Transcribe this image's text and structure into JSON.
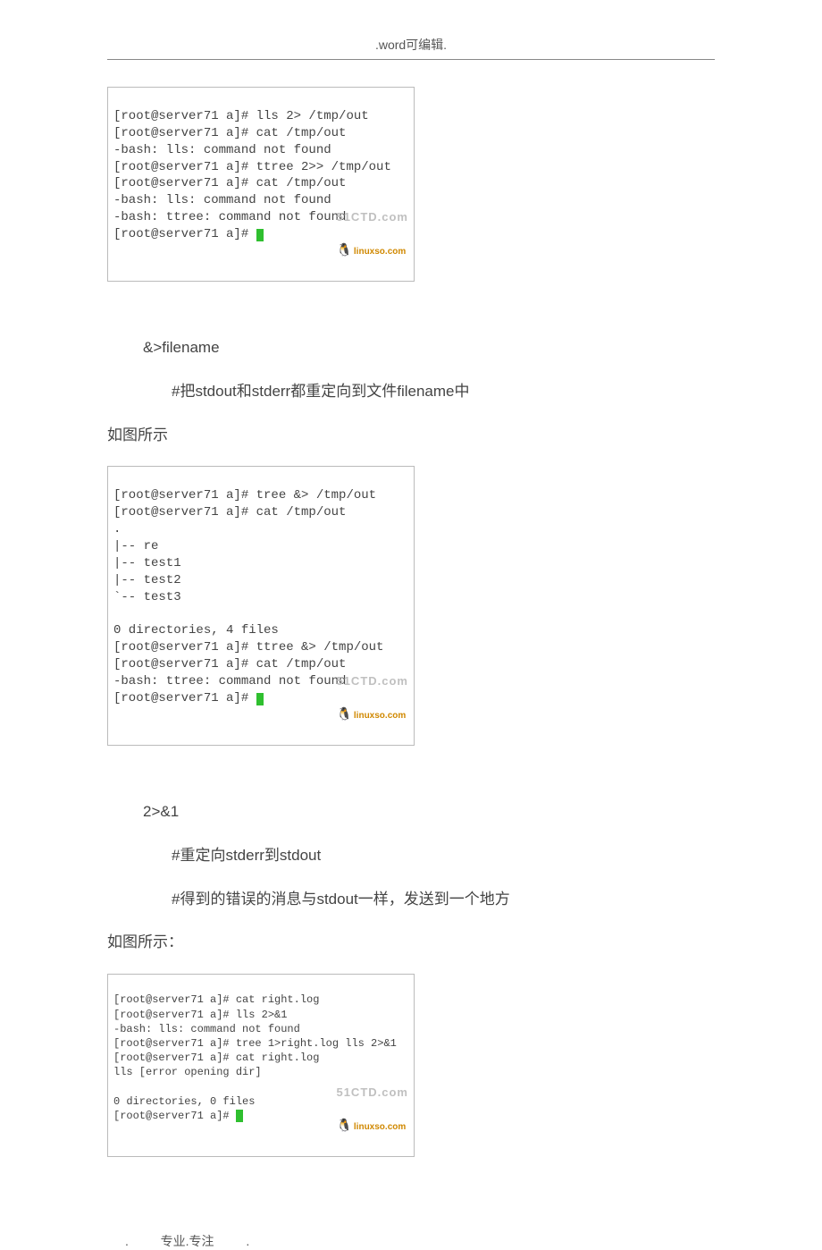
{
  "header": {
    "title": ".word可编辑."
  },
  "terminal1": {
    "line1": "[root@server71 a]# lls 2> /tmp/out",
    "line2": "[root@server71 a]# cat /tmp/out",
    "line3": "-bash: lls: command not found",
    "line4": "[root@server71 a]# ttree 2>> /tmp/out",
    "line5": "[root@server71 a]# cat /tmp/out",
    "line6": "-bash: lls: command not found",
    "line7": "-bash: ttree: command not found",
    "line8": "[root@server71 a]# ",
    "wm_big": "51CTD.com",
    "wm_small": "linuxso.com"
  },
  "para1": {
    "t1": "&>filename",
    "t2": "#把stdout和stderr都重定向到文件filename中",
    "t3": "如图所示"
  },
  "terminal2": {
    "line1": "[root@server71 a]# tree &> /tmp/out",
    "line2": "[root@server71 a]# cat /tmp/out",
    "line3": ".",
    "line4": "|-- re",
    "line5": "|-- test1",
    "line6": "|-- test2",
    "line7": "`-- test3",
    "line8": "0 directories, 4 files",
    "line9": "[root@server71 a]# ttree &> /tmp/out",
    "line10": "[root@server71 a]# cat /tmp/out",
    "line11": "-bash: ttree: command not found",
    "line12": "[root@server71 a]# ",
    "wm_big": "51CTD.com",
    "wm_small": "linuxso.com"
  },
  "para2": {
    "t1": "2>&1",
    "t2": "#重定向stderr到stdout",
    "t3": "#得到的错误的消息与stdout一样，发送到一个地方",
    "t4": "如图所示："
  },
  "terminal3": {
    "line1": "[root@server71 a]# cat right.log",
    "line2": "[root@server71 a]# lls 2>&1",
    "line3": "-bash: lls: command not found",
    "line4": "[root@server71 a]# tree 1>right.log lls 2>&1",
    "line5": "[root@server71 a]# cat right.log",
    "line6": "lls [error opening dir]",
    "line7": "0 directories, 0 files",
    "line8": "[root@server71 a]# ",
    "wm_big": "51CTD.com",
    "wm_small": "linuxso.com"
  },
  "footer": {
    "left_dot": ".",
    "text": "专业.专注",
    "right_dot": "."
  }
}
